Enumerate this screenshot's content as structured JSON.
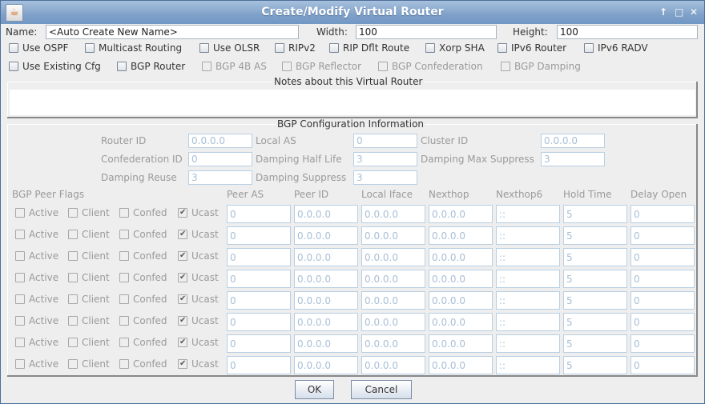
{
  "window": {
    "title": "Create/Modify Virtual Router",
    "app_icon": "java-cup-icon",
    "controls": {
      "up": "↑",
      "maximize": "□",
      "close": "✕"
    }
  },
  "top": {
    "name_label": "Name:",
    "name_value": "<Auto Create New Name>",
    "width_label": "Width:",
    "width_value": "100",
    "height_label": "Height:",
    "height_value": "100"
  },
  "options_row1": [
    {
      "label": "Use OSPF",
      "checked": false,
      "enabled": true
    },
    {
      "label": "Multicast Routing",
      "checked": false,
      "enabled": true
    },
    {
      "label": "Use OLSR",
      "checked": false,
      "enabled": true
    },
    {
      "label": "RIPv2",
      "checked": false,
      "enabled": true
    },
    {
      "label": "RIP Dflt Route",
      "checked": false,
      "enabled": true
    },
    {
      "label": "Xorp SHA",
      "checked": false,
      "enabled": true
    },
    {
      "label": "IPv6 Router",
      "checked": false,
      "enabled": true
    },
    {
      "label": "IPv6 RADV",
      "checked": false,
      "enabled": true
    }
  ],
  "options_row2": [
    {
      "label": "Use Existing Cfg",
      "checked": false,
      "enabled": true
    },
    {
      "label": "BGP Router",
      "checked": false,
      "enabled": true
    },
    {
      "label": "BGP 4B AS",
      "checked": false,
      "enabled": false
    },
    {
      "label": "BGP Reflector",
      "checked": false,
      "enabled": false
    },
    {
      "label": "BGP Confederation",
      "checked": false,
      "enabled": false
    },
    {
      "label": "BGP Damping",
      "checked": false,
      "enabled": false
    }
  ],
  "notes": {
    "title": "Notes about this Virtual Router",
    "value": ""
  },
  "bgp": {
    "title": "BGP Configuration Information",
    "router_id_label": "Router ID",
    "router_id": "0.0.0.0",
    "local_as_label": "Local AS",
    "local_as": "0",
    "cluster_id_label": "Cluster ID",
    "cluster_id": "0.0.0.0",
    "confed_id_label": "Confederation ID",
    "confed_id": "0",
    "damp_half_label": "Damping Half Life",
    "damp_half": "3",
    "damp_max_label": "Damping Max Suppress",
    "damp_max": "3",
    "damp_reuse_label": "Damping Reuse",
    "damp_reuse": "3",
    "damp_supp_label": "Damping Suppress",
    "damp_supp": "3",
    "peer_flags_label": "BGP Peer Flags",
    "columns": [
      "Peer AS",
      "Peer ID",
      "Local Iface",
      "Nexthop",
      "Nexthop6",
      "Hold Time",
      "Delay Open"
    ],
    "flag_labels": [
      "Active",
      "Client",
      "Confed",
      "Ucast"
    ],
    "peers": [
      {
        "active": false,
        "client": false,
        "confed": false,
        "ucast": true,
        "values": [
          "0",
          "0.0.0.0",
          "0.0.0.0",
          "0.0.0.0",
          "::",
          "5",
          "0"
        ]
      },
      {
        "active": false,
        "client": false,
        "confed": false,
        "ucast": true,
        "values": [
          "0",
          "0.0.0.0",
          "0.0.0.0",
          "0.0.0.0",
          "::",
          "5",
          "0"
        ]
      },
      {
        "active": false,
        "client": false,
        "confed": false,
        "ucast": true,
        "values": [
          "0",
          "0.0.0.0",
          "0.0.0.0",
          "0.0.0.0",
          "::",
          "5",
          "0"
        ]
      },
      {
        "active": false,
        "client": false,
        "confed": false,
        "ucast": true,
        "values": [
          "0",
          "0.0.0.0",
          "0.0.0.0",
          "0.0.0.0",
          "::",
          "5",
          "0"
        ]
      },
      {
        "active": false,
        "client": false,
        "confed": false,
        "ucast": true,
        "values": [
          "0",
          "0.0.0.0",
          "0.0.0.0",
          "0.0.0.0",
          "::",
          "5",
          "0"
        ]
      },
      {
        "active": false,
        "client": false,
        "confed": false,
        "ucast": true,
        "values": [
          "0",
          "0.0.0.0",
          "0.0.0.0",
          "0.0.0.0",
          "::",
          "5",
          "0"
        ]
      },
      {
        "active": false,
        "client": false,
        "confed": false,
        "ucast": true,
        "values": [
          "0",
          "0.0.0.0",
          "0.0.0.0",
          "0.0.0.0",
          "::",
          "5",
          "0"
        ]
      },
      {
        "active": false,
        "client": false,
        "confed": false,
        "ucast": true,
        "values": [
          "0",
          "0.0.0.0",
          "0.0.0.0",
          "0.0.0.0",
          "::",
          "5",
          "0"
        ]
      }
    ]
  },
  "buttons": {
    "ok": "OK",
    "cancel": "Cancel"
  }
}
